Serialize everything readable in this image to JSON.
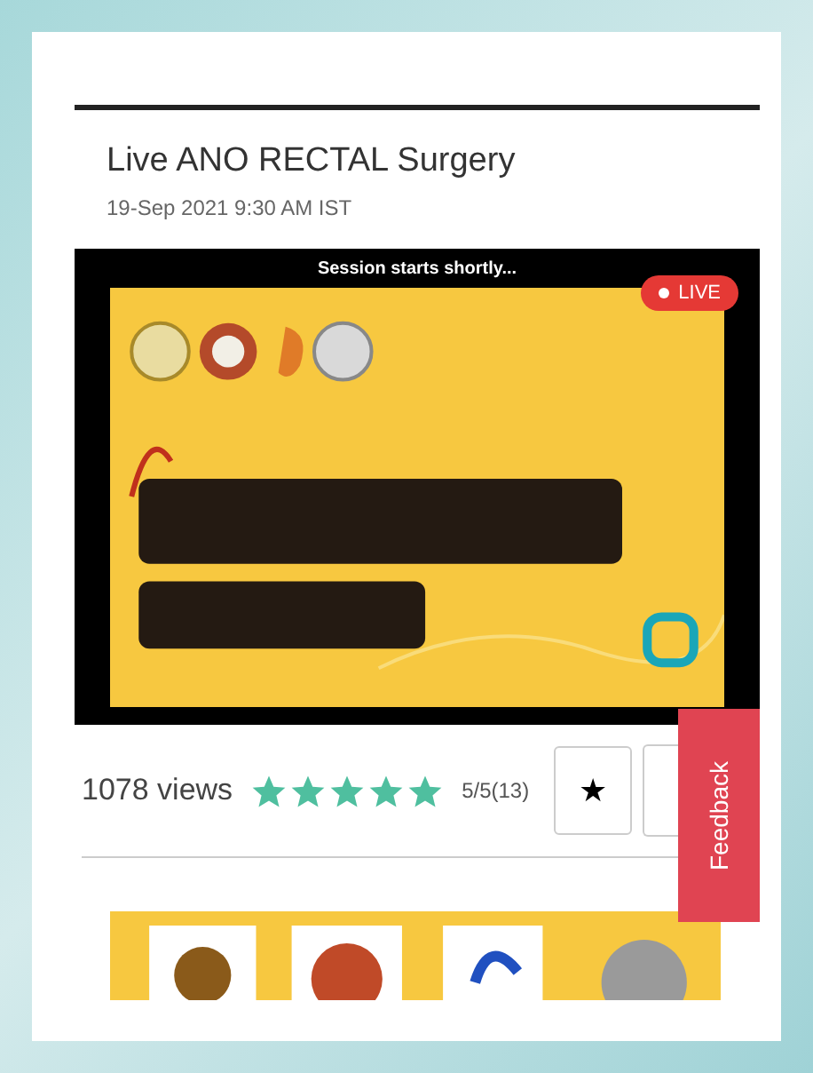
{
  "event": {
    "title": "Live ANO RECTAL Surgery",
    "date": "19-Sep 2021 9:30 AM IST"
  },
  "player": {
    "notice": "Session starts shortly...",
    "live_badge": "LIVE"
  },
  "stats": {
    "views": "1078 views",
    "stars": 5,
    "rating": "5/5(13)",
    "favorite_button": "★"
  },
  "feedback_tab": "Feedback"
}
